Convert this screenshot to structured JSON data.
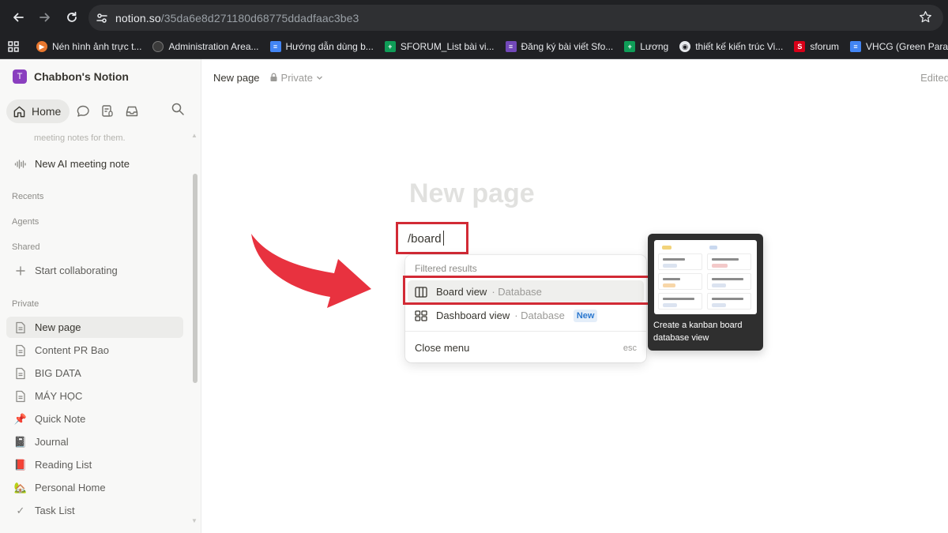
{
  "browser": {
    "url_host": "notion.so",
    "url_path": "/35da6e8d271180d68775ddadfaac3be3",
    "bookmarks": [
      {
        "label": "Nén hình ảnh trực t...",
        "color": "#e8772e"
      },
      {
        "label": "Administration Area...",
        "color": "#3b3b3b"
      },
      {
        "label": "Hướng dẫn dùng b...",
        "color": "#4285f4"
      },
      {
        "label": "SFORUM_List bài vi...",
        "color": "#0f9d58"
      },
      {
        "label": "Đăng ký bài viết Sfo...",
        "color": "#7248b9"
      },
      {
        "label": "Lương",
        "color": "#0f9d58"
      },
      {
        "label": "thiết kế kiến trúc Vi...",
        "color": "#5f6368"
      },
      {
        "label": "sforum",
        "color": "#d70018"
      },
      {
        "label": "VHCG (Green Paradi...",
        "color": "#4285f4"
      }
    ]
  },
  "sidebar": {
    "workspace_initial": "T",
    "workspace_name": "Chabbon's Notion",
    "home_label": "Home",
    "faded_text": "meeting notes for them.",
    "ai_note": "New AI meeting note",
    "recents": "Recents",
    "agents": "Agents",
    "shared": "Shared",
    "start_collab": "Start collaborating",
    "private": "Private",
    "pages": [
      {
        "label": "New page",
        "icon": "page-icon",
        "glyph": ""
      },
      {
        "label": "Content PR Bao",
        "icon": "page-icon",
        "glyph": ""
      },
      {
        "label": "BIG DATA",
        "icon": "page-icon",
        "glyph": ""
      },
      {
        "label": "MÁY HỌC",
        "icon": "page-icon",
        "glyph": ""
      },
      {
        "label": "Quick Note",
        "icon": "pushpin-icon",
        "glyph": "📌"
      },
      {
        "label": "Journal",
        "icon": "notebook-icon",
        "glyph": "📓"
      },
      {
        "label": "Reading List",
        "icon": "book-icon",
        "glyph": "📕"
      },
      {
        "label": "Personal Home",
        "icon": "house-icon",
        "glyph": "🏡"
      },
      {
        "label": "Task List",
        "icon": "checkmark-icon",
        "glyph": "✓"
      }
    ]
  },
  "header": {
    "crumb": "New page",
    "privacy": "Private",
    "edited": "Edited"
  },
  "editor": {
    "title_placeholder": "New page",
    "command_text": "/board"
  },
  "menu": {
    "heading": "Filtered results",
    "items": [
      {
        "label": "Board view",
        "sub": "· Database"
      },
      {
        "label": "Dashboard view",
        "sub": "· Database",
        "badge": "New"
      }
    ],
    "close": "Close menu",
    "esc": "esc"
  },
  "preview": {
    "caption": "Create a kanban board database view",
    "col1_tag": "Beta",
    "col2_tag": "1.0",
    "col1_cards": [
      {
        "title": "Comments",
        "tag": "Product"
      },
      {
        "title": "Tutorial",
        "tag": "Support"
      },
      {
        "title": "In-App Notifications",
        "tag": "Product"
      }
    ],
    "col2_cards": [
      {
        "title": "Analytics 1.0",
        "tag": "Analytics"
      },
      {
        "title": "Location Sharing",
        "tag": "Product"
      },
      {
        "title": "Realtime Editing",
        "tag": "Product"
      }
    ]
  },
  "colors": {
    "highlight_red": "#d22a35",
    "arrow_red": "#e8323f"
  }
}
